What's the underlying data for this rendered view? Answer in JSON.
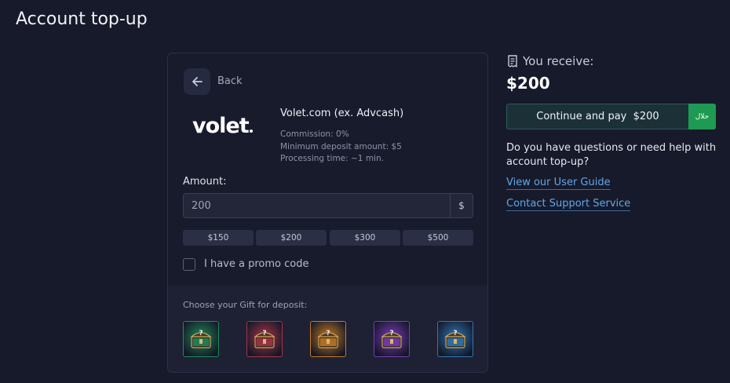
{
  "page": {
    "title": "Account top-up"
  },
  "card": {
    "back_label": "Back",
    "logo_text": "volet",
    "method_name": "Volet.com (ex. Advcash)",
    "commission": "Commission: 0%",
    "min_deposit": "Minimum deposit amount: $5",
    "processing": "Processing time: ~1 min.",
    "amount_label": "Amount:",
    "amount_value": "200",
    "currency": "$",
    "presets": [
      "$150",
      "$200",
      "$300",
      "$500"
    ],
    "promo_label": "I have a promo code",
    "gift_title": "Choose your Gift for deposit:",
    "gifts": [
      {
        "name": "green",
        "color": "#1f8a5b"
      },
      {
        "name": "red",
        "color": "#a8344a"
      },
      {
        "name": "orange",
        "color": "#c77a24"
      },
      {
        "name": "purple",
        "color": "#7a3bbd"
      },
      {
        "name": "blue",
        "color": "#2f78b8"
      }
    ]
  },
  "summary": {
    "receive_label": "You receive:",
    "receive_amount": "$200",
    "pay_label": "Continue and pay  $200",
    "halal_label": "حلال",
    "help_text": "Do you have questions or need help with account top-up?",
    "guide_link": "View our User Guide",
    "support_link": "Contact Support Service"
  },
  "colors": {
    "background": "#171a2b",
    "link": "#5fa7e8",
    "halal": "#1e9a53",
    "pay_border": "#2c5a52"
  }
}
